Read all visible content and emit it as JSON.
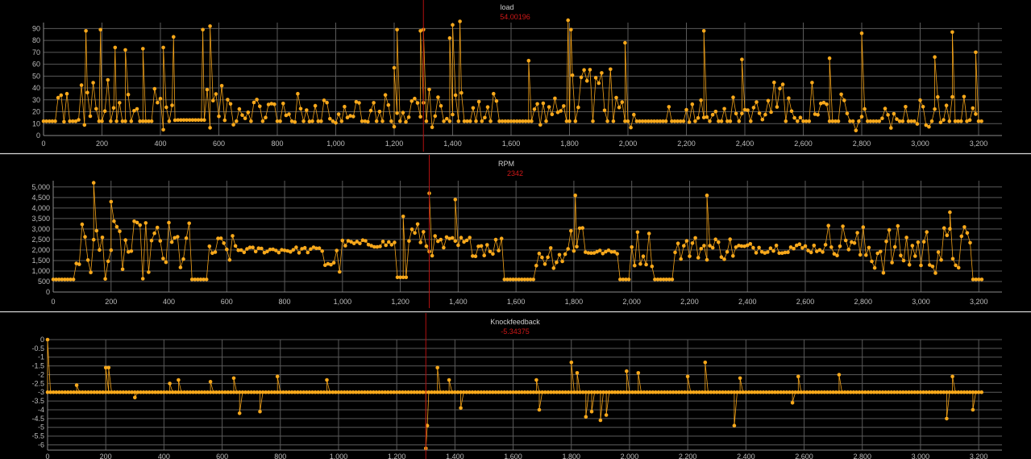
{
  "colors": {
    "background": "#000000",
    "series": "#f7a81b",
    "cursor": "#b01010",
    "grid": "#5a5a5a",
    "separator": "#d8d8d8"
  },
  "chart_data": [
    {
      "type": "line",
      "title": "load",
      "cursor_value": "54.00196",
      "cursor_x": 1300,
      "xlim": [
        0,
        3280
      ],
      "ylim": [
        0,
        95
      ],
      "x_ticks": [
        0,
        200,
        400,
        600,
        800,
        1000,
        1200,
        1400,
        1600,
        1800,
        2000,
        2200,
        2400,
        2600,
        2800,
        3000,
        3200
      ],
      "x_tick_labels": [
        "0",
        "200",
        "400",
        "600",
        "800",
        "1,000",
        "1,200",
        "1,400",
        "1,600",
        "1,800",
        "2,000",
        "2,200",
        "2,400",
        "2,600",
        "2,800",
        "3,000",
        "3,200"
      ],
      "y_ticks": [
        0,
        10,
        20,
        30,
        40,
        50,
        60,
        70,
        80,
        90
      ],
      "y_tick_labels": [
        "0",
        "10",
        "20",
        "30",
        "40",
        "50",
        "60",
        "70",
        "80",
        "90"
      ],
      "grid": true,
      "baseline": 12,
      "segments": [
        {
          "x0": 0,
          "x1": 40,
          "level": 12
        },
        {
          "x0": 40,
          "x1": 460,
          "level": 26,
          "spread": 22
        },
        {
          "x0": 460,
          "x1": 560,
          "level": 13
        },
        {
          "x0": 560,
          "x1": 700,
          "level": 24,
          "spread": 18
        },
        {
          "x0": 700,
          "x1": 940,
          "level": 22,
          "spread": 14
        },
        {
          "x0": 940,
          "x1": 1180,
          "level": 22,
          "spread": 14
        },
        {
          "x0": 1180,
          "x1": 1300,
          "level": 22,
          "spread": 16
        },
        {
          "x0": 1300,
          "x1": 1560,
          "level": 24,
          "spread": 18
        },
        {
          "x0": 1560,
          "x1": 1670,
          "level": 12
        },
        {
          "x0": 1670,
          "x1": 1790,
          "level": 20,
          "spread": 12
        },
        {
          "x0": 1790,
          "x1": 1950,
          "level": 38,
          "spread": 18
        },
        {
          "x0": 1950,
          "x1": 2050,
          "level": 20,
          "spread": 14
        },
        {
          "x0": 2050,
          "x1": 2140,
          "level": 12
        },
        {
          "x0": 2140,
          "x1": 2500,
          "level": 22,
          "spread": 12
        },
        {
          "x0": 2500,
          "x1": 2660,
          "level": 28,
          "spread": 18
        },
        {
          "x0": 2660,
          "x1": 3200,
          "level": 20,
          "spread": 16
        },
        {
          "x0": 3200,
          "x1": 3280,
          "level": 12
        }
      ],
      "spikes": [
        {
          "x": 145,
          "y": 88
        },
        {
          "x": 195,
          "y": 89
        },
        {
          "x": 245,
          "y": 74
        },
        {
          "x": 280,
          "y": 72
        },
        {
          "x": 340,
          "y": 73
        },
        {
          "x": 410,
          "y": 74
        },
        {
          "x": 445,
          "y": 83
        },
        {
          "x": 545,
          "y": 89
        },
        {
          "x": 570,
          "y": 92
        },
        {
          "x": 1200,
          "y": 57
        },
        {
          "x": 1210,
          "y": 89
        },
        {
          "x": 1290,
          "y": 88
        },
        {
          "x": 1300,
          "y": 89
        },
        {
          "x": 1390,
          "y": 82
        },
        {
          "x": 1400,
          "y": 93
        },
        {
          "x": 1425,
          "y": 96
        },
        {
          "x": 1660,
          "y": 63
        },
        {
          "x": 1795,
          "y": 97
        },
        {
          "x": 1805,
          "y": 89
        },
        {
          "x": 1990,
          "y": 78
        },
        {
          "x": 2260,
          "y": 88
        },
        {
          "x": 2390,
          "y": 64
        },
        {
          "x": 2690,
          "y": 65
        },
        {
          "x": 2800,
          "y": 86
        },
        {
          "x": 3050,
          "y": 66
        },
        {
          "x": 3110,
          "y": 87
        },
        {
          "x": 3190,
          "y": 70
        }
      ]
    },
    {
      "type": "line",
      "title": "RPM",
      "cursor_value": "2342",
      "cursor_x": 1300,
      "xlim": [
        0,
        3280
      ],
      "ylim": [
        0,
        5300
      ],
      "x_ticks": [
        0,
        200,
        400,
        600,
        800,
        1000,
        1200,
        1400,
        1600,
        1800,
        2000,
        2200,
        2400,
        2600,
        2800,
        3000,
        3200
      ],
      "x_tick_labels": [
        "0",
        "200",
        "400",
        "600",
        "800",
        "1,000",
        "1,200",
        "1,400",
        "1,600",
        "1,800",
        "2,000",
        "2,200",
        "2,400",
        "2,600",
        "2,800",
        "3,000",
        "3,200"
      ],
      "y_ticks": [
        0,
        500,
        1000,
        1500,
        2000,
        2500,
        3000,
        3500,
        4000,
        4500,
        5000
      ],
      "y_tick_labels": [
        "0",
        "500",
        "1,000",
        "1,500",
        "2,000",
        "2,500",
        "3,000",
        "3,500",
        "4,000",
        "4,500",
        "5,000"
      ],
      "grid": true,
      "segments": [
        {
          "x0": 0,
          "x1": 80,
          "level": 600
        },
        {
          "x0": 80,
          "x1": 480,
          "level": 2000,
          "spread": 1400
        },
        {
          "x0": 480,
          "x1": 540,
          "level": 600
        },
        {
          "x0": 540,
          "x1": 640,
          "level": 2000,
          "spread": 700
        },
        {
          "x0": 640,
          "x1": 940,
          "level": 2000,
          "spread": 150
        },
        {
          "x0": 940,
          "x1": 1000,
          "level": 1500,
          "spread": 700
        },
        {
          "x0": 1000,
          "x1": 1190,
          "level": 2300,
          "spread": 180
        },
        {
          "x0": 1190,
          "x1": 1230,
          "level": 700
        },
        {
          "x0": 1230,
          "x1": 1290,
          "level": 2700,
          "spread": 600
        },
        {
          "x0": 1290,
          "x1": 1560,
          "level": 2200,
          "spread": 500
        },
        {
          "x0": 1560,
          "x1": 1670,
          "level": 600
        },
        {
          "x0": 1670,
          "x1": 1790,
          "level": 1800,
          "spread": 700
        },
        {
          "x0": 1790,
          "x1": 1840,
          "level": 2800,
          "spread": 1300
        },
        {
          "x0": 1840,
          "x1": 1960,
          "level": 1900,
          "spread": 100
        },
        {
          "x0": 1960,
          "x1": 2000,
          "level": 600
        },
        {
          "x0": 2000,
          "x1": 2080,
          "level": 2100,
          "spread": 900
        },
        {
          "x0": 2080,
          "x1": 2150,
          "level": 600
        },
        {
          "x0": 2150,
          "x1": 2360,
          "level": 2100,
          "spread": 600
        },
        {
          "x0": 2360,
          "x1": 2680,
          "level": 2100,
          "spread": 250
        },
        {
          "x0": 2680,
          "x1": 2770,
          "level": 2500,
          "spread": 800
        },
        {
          "x0": 2770,
          "x1": 3180,
          "level": 2000,
          "spread": 1200
        },
        {
          "x0": 3180,
          "x1": 3280,
          "level": 600
        }
      ],
      "spikes": [
        {
          "x": 140,
          "y": 5200
        },
        {
          "x": 200,
          "y": 4300
        },
        {
          "x": 1210,
          "y": 3600
        },
        {
          "x": 1300,
          "y": 4700
        },
        {
          "x": 1390,
          "y": 4400
        },
        {
          "x": 1805,
          "y": 4600
        },
        {
          "x": 2260,
          "y": 4600
        },
        {
          "x": 3100,
          "y": 3800
        }
      ]
    },
    {
      "type": "line",
      "title": "Knockfeedback",
      "cursor_value": "-5.34375",
      "cursor_x": 1300,
      "xlim": [
        0,
        3280
      ],
      "ylim": [
        -6.3,
        0
      ],
      "x_ticks": [
        0,
        200,
        400,
        600,
        800,
        1000,
        1200,
        1400,
        1600,
        1800,
        2000,
        2200,
        2400,
        2600,
        2800,
        3000,
        3200
      ],
      "x_tick_labels": [
        "0",
        "200",
        "400",
        "600",
        "800",
        "1,000",
        "1,200",
        "1,400",
        "1,600",
        "1,800",
        "2,000",
        "2,200",
        "2,400",
        "2,600",
        "2,800",
        "3,000",
        "3,200"
      ],
      "y_ticks": [
        0,
        -0.5,
        -1,
        -1.5,
        -2,
        -2.5,
        -3,
        -3.5,
        -4,
        -4.5,
        -5,
        -5.5,
        -6
      ],
      "y_tick_labels": [
        "0",
        "-0.5",
        "-1",
        "-1.5",
        "-2",
        "-2.5",
        "-3",
        "-3.5",
        "-4",
        "-4.5",
        "-5",
        "-5.5",
        "-6"
      ],
      "grid": true,
      "baseline": -3,
      "spikes": [
        {
          "x": 0,
          "y": 0
        },
        {
          "x": 100,
          "y": -2.6
        },
        {
          "x": 200,
          "y": -1.6
        },
        {
          "x": 210,
          "y": -1.6
        },
        {
          "x": 300,
          "y": -3.3
        },
        {
          "x": 420,
          "y": -2.5
        },
        {
          "x": 450,
          "y": -2.3
        },
        {
          "x": 560,
          "y": -2.4
        },
        {
          "x": 640,
          "y": -2.2
        },
        {
          "x": 660,
          "y": -4.2
        },
        {
          "x": 730,
          "y": -4.1
        },
        {
          "x": 790,
          "y": -2.1
        },
        {
          "x": 960,
          "y": -2.3
        },
        {
          "x": 1300,
          "y": -6.2
        },
        {
          "x": 1305,
          "y": -4.9
        },
        {
          "x": 1340,
          "y": -1.6
        },
        {
          "x": 1380,
          "y": -2.3
        },
        {
          "x": 1420,
          "y": -3.9
        },
        {
          "x": 1680,
          "y": -2.3
        },
        {
          "x": 1690,
          "y": -4.0
        },
        {
          "x": 1800,
          "y": -1.3
        },
        {
          "x": 1820,
          "y": -1.9
        },
        {
          "x": 1850,
          "y": -4.4
        },
        {
          "x": 1870,
          "y": -4.1
        },
        {
          "x": 1900,
          "y": -4.6
        },
        {
          "x": 1920,
          "y": -4.3
        },
        {
          "x": 1990,
          "y": -1.8
        },
        {
          "x": 2030,
          "y": -1.9
        },
        {
          "x": 2200,
          "y": -2.1
        },
        {
          "x": 2260,
          "y": -1.3
        },
        {
          "x": 2360,
          "y": -4.9
        },
        {
          "x": 2380,
          "y": -2.2
        },
        {
          "x": 2560,
          "y": -3.6
        },
        {
          "x": 2580,
          "y": -2.1
        },
        {
          "x": 2720,
          "y": -2.0
        },
        {
          "x": 3090,
          "y": -4.5
        },
        {
          "x": 3110,
          "y": -2.1
        },
        {
          "x": 3180,
          "y": -4.0
        }
      ]
    }
  ]
}
